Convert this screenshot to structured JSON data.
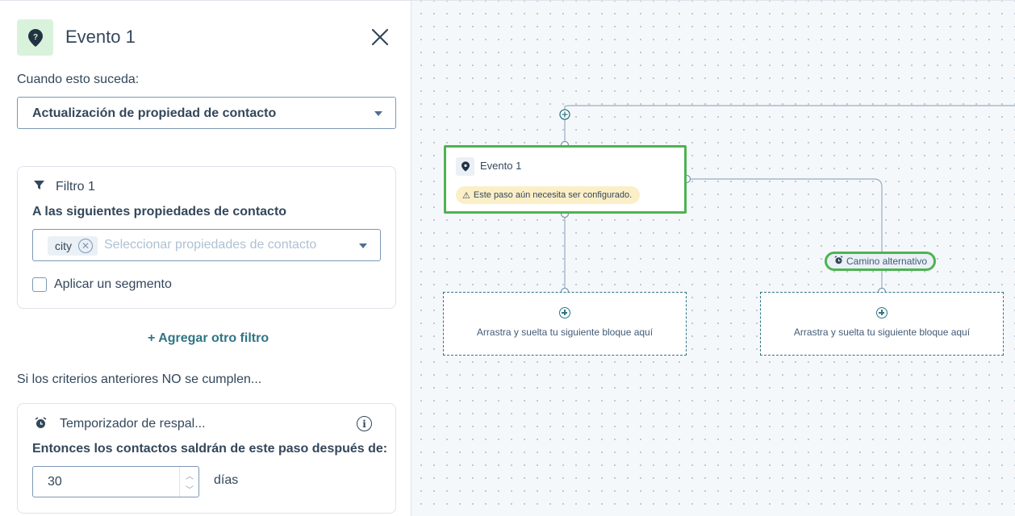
{
  "panel": {
    "title": "Evento 1",
    "when_label": "Cuando esto suceda:",
    "trigger_value": "Actualización de propiedad de contacto",
    "filter": {
      "title": "Filtro 1",
      "properties_label": "A las siguientes propiedades de contacto",
      "chip_label": "city",
      "properties_placeholder": "Seleccionar propiedades de contacto",
      "segment_label": "Aplicar un segmento"
    },
    "add_filter_label": "+ Agregar otro filtro",
    "not_met_label": "Si los criterios anteriores NO se cumplen...",
    "timer": {
      "title": "Temporizador de respal...",
      "exit_label": "Entonces los contactos saldrán de este paso después de:",
      "value": "30",
      "unit": "días"
    }
  },
  "canvas": {
    "node": {
      "title": "Evento 1",
      "warning": "Este paso aún necesita ser configurado."
    },
    "dropzone_text": "Arrastra y suelta tu siguiente bloque aquí",
    "alt_path_label": "Camino alternativo"
  },
  "colors": {
    "accent_green": "#4db352",
    "teal": "#2f7585",
    "warning_bg": "#fcefc7"
  }
}
